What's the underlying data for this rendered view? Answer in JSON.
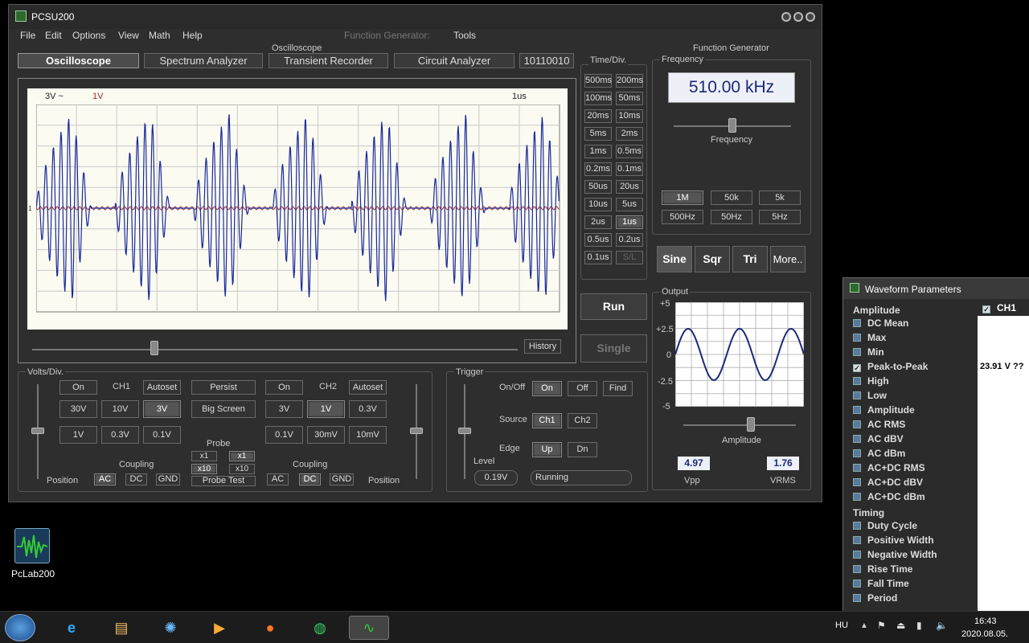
{
  "window": {
    "title": "PCSU200"
  },
  "menu": {
    "file": "File",
    "edit": "Edit",
    "options": "Options",
    "view": "View",
    "math": "Math",
    "help": "Help",
    "func_gen": "Function Generator:",
    "tools": "Tools"
  },
  "section_labels": {
    "oscilloscope": "Oscilloscope",
    "function_generator": "Function Generator"
  },
  "tabs": [
    {
      "label": "Oscilloscope"
    },
    {
      "label": "Spectrum Analyzer"
    },
    {
      "label": "Transient Recorder"
    },
    {
      "label": "Circuit Analyzer"
    },
    {
      "label": "10110010"
    }
  ],
  "scope": {
    "ch1_volts": "3V ~",
    "ch2_volts": "1V",
    "timebase": "1us",
    "marker_left": "1",
    "history": "History"
  },
  "timediv": {
    "title": "Time/Div.",
    "buttons": [
      "500ms",
      "200ms",
      "100ms",
      "50ms",
      "20ms",
      "10ms",
      "5ms",
      "2ms",
      "1ms",
      "0.5ms",
      "0.2ms",
      "0.1ms",
      "50us",
      "20us",
      "10us",
      "5us",
      "2us",
      "1us",
      "0.5us",
      "0.2us",
      "0.1us",
      "S/L"
    ]
  },
  "run": {
    "run": "Run",
    "single": "Single"
  },
  "fgen": {
    "frequency_title": "Frequency",
    "frequency_value": "510.00 kHz",
    "frequency_slider": "Frequency",
    "ranges": [
      "1M",
      "50k",
      "5k",
      "500Hz",
      "50Hz",
      "5Hz"
    ],
    "wave": {
      "sine": "Sine",
      "sqr": "Sqr",
      "tri": "Tri",
      "more": "More.."
    },
    "output_title": "Output",
    "y_ticks": [
      "+5",
      "+2.5",
      "0",
      "-2.5",
      "-5"
    ],
    "amplitude_label": "Amplitude",
    "vpp_value": "4.97",
    "vpp_label": "Vpp",
    "vrms_value": "1.76",
    "vrms_label": "VRMS"
  },
  "volts": {
    "title": "Volts/Div.",
    "ch1": {
      "on": "On",
      "name": "CH1",
      "autoset": "Autoset",
      "r1": [
        "30V",
        "10V",
        "3V"
      ],
      "r2": [
        "1V",
        "0.3V",
        "0.1V"
      ]
    },
    "ch2": {
      "on": "On",
      "name": "CH2",
      "autoset": "Autoset",
      "r1": [
        "3V",
        "1V",
        "0.3V"
      ],
      "r2": [
        "0.1V",
        "30mV",
        "10mV"
      ]
    },
    "persist": "Persist",
    "big_screen": "Big Screen",
    "probe": "Probe",
    "x1": "x1",
    "x10": "x10",
    "probe_test": "Probe Test",
    "coupling": "Coupling",
    "ac": "AC",
    "dc": "DC",
    "gnd": "GND",
    "position": "Position"
  },
  "trigger": {
    "title": "Trigger",
    "onoff": "On/Off",
    "on": "On",
    "off": "Off",
    "find": "Find",
    "source": "Source",
    "ch1": "Ch1",
    "ch2": "Ch2",
    "edge": "Edge",
    "up": "Up",
    "dn": "Dn",
    "level": "Level",
    "level_value": "0.19V",
    "status": "Running"
  },
  "desktop": {
    "icon_label": "PcLab200"
  },
  "wparams": {
    "title": "Waveform Parameters",
    "amplitude_header": "Amplitude",
    "channel": "CH1",
    "items": [
      "DC  Mean",
      "Max",
      "Min",
      "Peak-to-Peak",
      "High",
      "Low",
      "Amplitude",
      "AC RMS",
      "AC dBV",
      "AC dBm",
      "AC+DC RMS",
      "AC+DC dBV",
      "AC+DC dBm"
    ],
    "p2p_value": "23.91 V ??",
    "timing_header": "Timing",
    "timing_items": [
      "Duty Cycle",
      "Positive Width",
      "Negative Width",
      "Rise Time",
      "Fall Time",
      "Period"
    ]
  },
  "taskbar": {
    "lang": "HU",
    "time": "16:43",
    "date": "2020.08.05."
  }
}
